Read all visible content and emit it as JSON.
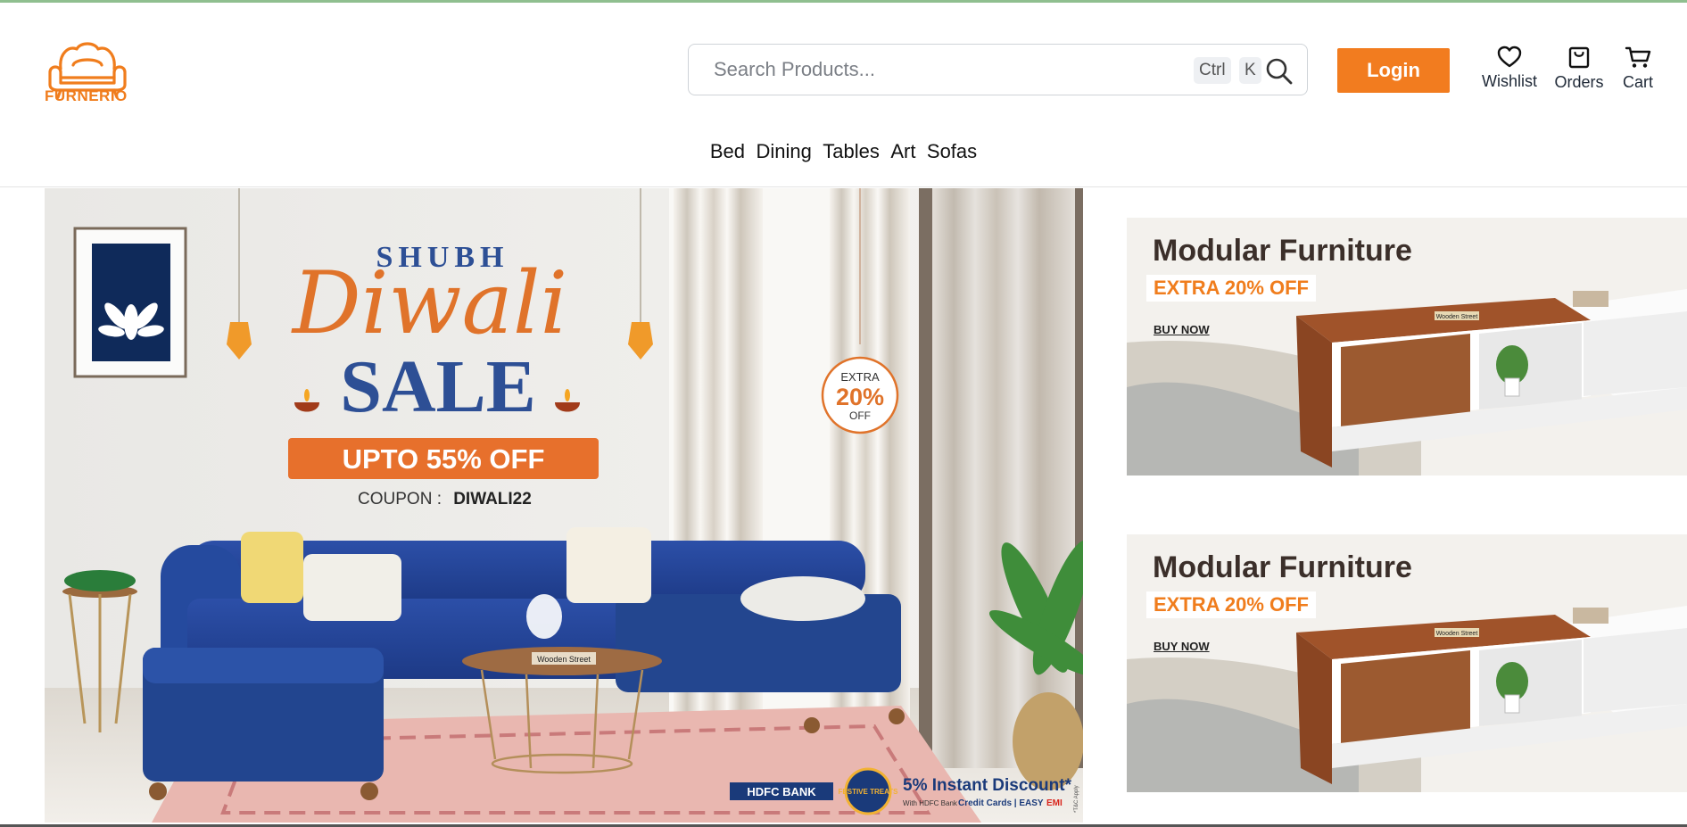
{
  "brand": {
    "name": "FURNERIO",
    "accent_color": "#f27c1f"
  },
  "search": {
    "placeholder": "Search Products...",
    "shortcut_ctrl": "Ctrl",
    "shortcut_key": "K",
    "icon": "search-icon"
  },
  "header": {
    "login_label": "Login",
    "actions": [
      {
        "label": "Wishlist",
        "icon": "heart-icon"
      },
      {
        "label": "Orders",
        "icon": "shopping-bag-icon"
      },
      {
        "label": "Cart",
        "icon": "cart-icon"
      }
    ]
  },
  "categories": [
    "Bed",
    "Dining",
    "Tables",
    "Art",
    "Sofas"
  ],
  "hero": {
    "line1": "SHUBH",
    "line2": "Diwali",
    "line3": "SALE",
    "discount": "UPTO 55% OFF",
    "coupon_label": "COUPON : ",
    "coupon_code": "DIWALI22",
    "badge_top": "EXTRA",
    "badge_value": "20%",
    "badge_bottom": "OFF",
    "bank": "HDFC BANK",
    "festive": "FESTIVE TREATS",
    "instant_discount": "5% Instant Discount*",
    "bank_note_prefix": "With HDFC Bank",
    "bank_note_cards": "Credit Cards | EASY",
    "bank_note_emi": "EMI",
    "tc": "*T&C Apply",
    "table_tag": "Wooden Street"
  },
  "side_banners": [
    {
      "title": "Modular Furniture",
      "offer": "EXTRA 20% OFF",
      "cta": "BUY NOW",
      "tag": "Wooden Street"
    },
    {
      "title": "Modular Furniture",
      "offer": "EXTRA 20% OFF",
      "cta": "BUY NOW",
      "tag": "Wooden Street"
    }
  ]
}
